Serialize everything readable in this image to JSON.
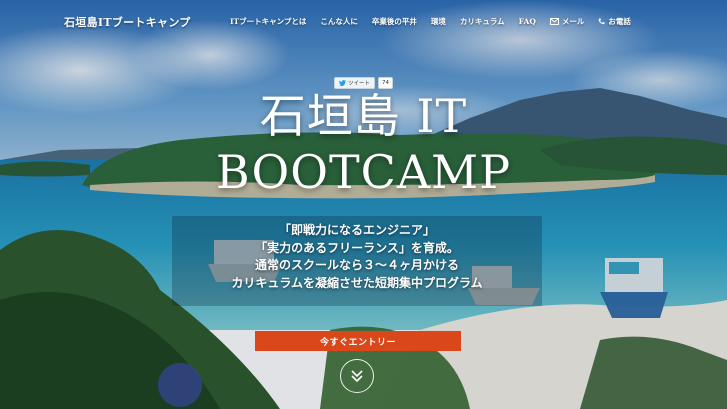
{
  "header": {
    "brand": "石垣島ITブートキャンプ",
    "nav": [
      {
        "label": "ITブートキャンプとは"
      },
      {
        "label": "こんな人に"
      },
      {
        "label": "卒業後の平井"
      },
      {
        "label": "環境"
      },
      {
        "label": "カリキュラム"
      },
      {
        "label": "FAQ"
      },
      {
        "label": "メール",
        "icon": "mail-icon"
      },
      {
        "label": "お電話",
        "icon": "phone-icon"
      }
    ]
  },
  "tweet": {
    "label": "ツイート",
    "count": "74"
  },
  "hero": {
    "title_line1": "石垣島 IT",
    "title_line2": "BOOTCAMP",
    "copy": [
      "「即戦力になるエンジニア」",
      "「実力のあるフリーランス」を育成。",
      "通常のスクールなら３〜４ヶ月かける",
      "カリキュラムを凝縮させた短期集中プログラム"
    ],
    "cta_label": "今すぐエントリー"
  },
  "colors": {
    "accent": "#d9471a",
    "sea": "#1f8fc0",
    "sky": "#4a86c8"
  }
}
